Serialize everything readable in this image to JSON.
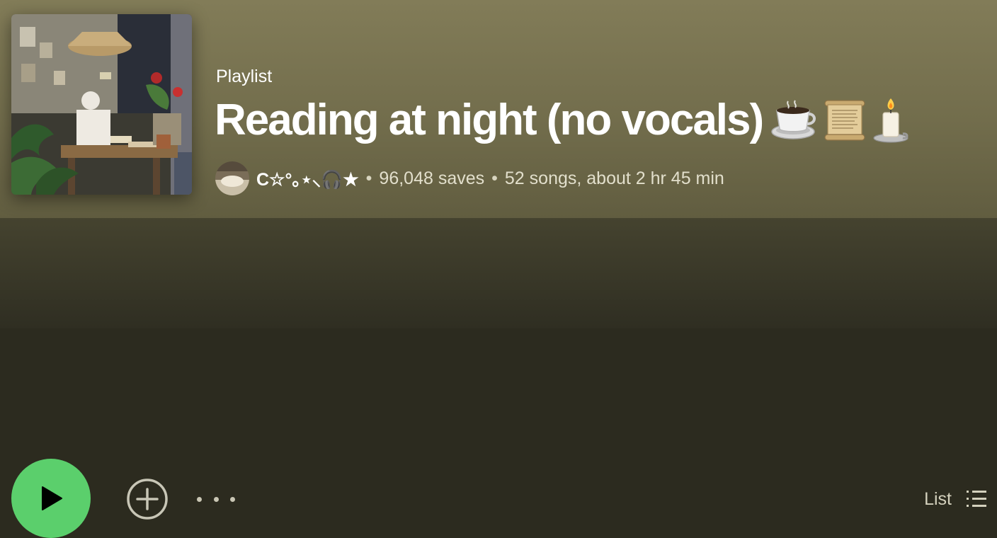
{
  "playlist": {
    "type_label": "Playlist",
    "title": "Reading at night (no vocals)",
    "title_emojis": [
      "coffee-cup",
      "scroll",
      "candle"
    ],
    "owner": "C☆°｡⋆⸜🎧★",
    "separator": "•",
    "saves": "96,048 saves",
    "summary": "52 songs, about 2 hr 45 min"
  },
  "controls": {
    "play_icon": "play-icon",
    "add_icon": "plus-circle-icon",
    "more_icon": "more-dots-icon",
    "view_label": "List",
    "view_icon": "list-icon"
  },
  "colors": {
    "accent_play": "#5bcf6c",
    "hero_bg": "#7d7756",
    "controls_bg": "#3c3a2a"
  }
}
